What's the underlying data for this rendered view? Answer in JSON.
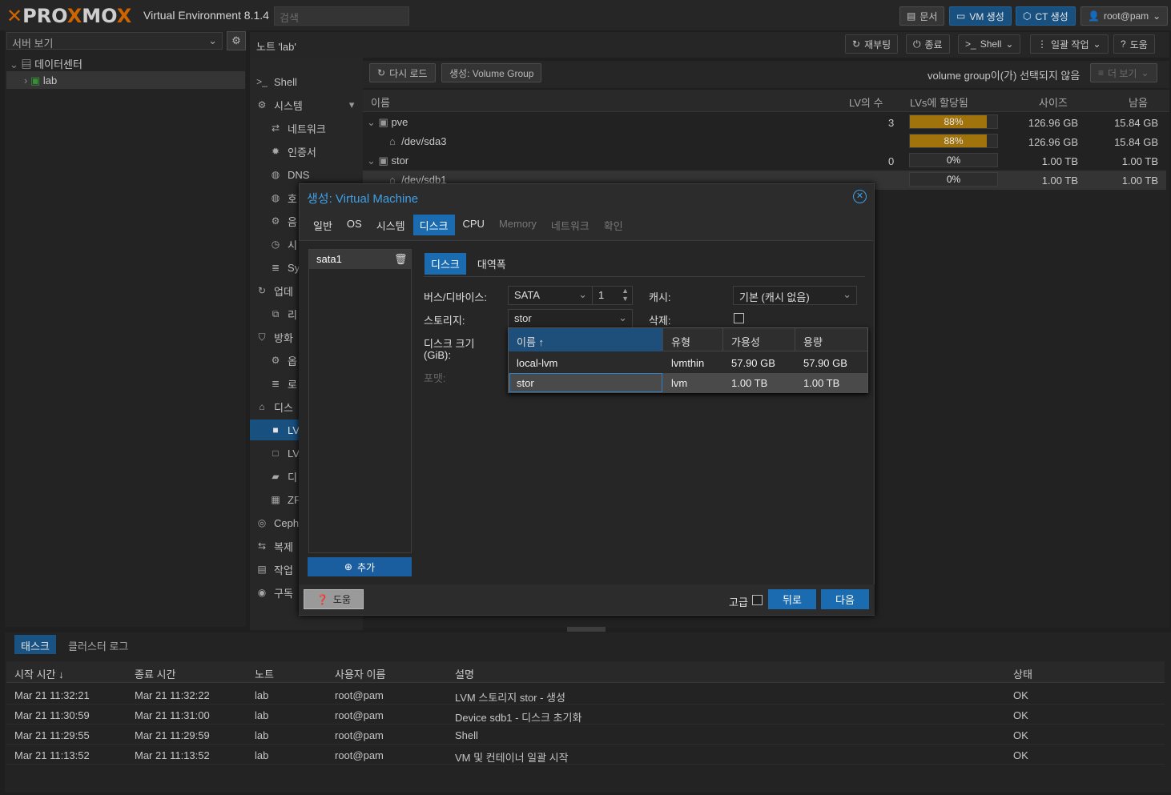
{
  "header": {
    "brand_a": "PRO",
    "brand_b": "X",
    "brand_c": "MO",
    "brand_d": "X",
    "version": "Virtual Environment 8.1.4",
    "search_placeholder": "검색",
    "docs": "문서",
    "create_vm": "VM 생성",
    "create_ct": "CT 생성",
    "user": "root@pam"
  },
  "sidebar": {
    "view": "서버 보기",
    "datacenter": "데이터센터",
    "node": "lab"
  },
  "titlebar": {
    "title": "노트 'lab'",
    "reboot": "재부팅",
    "shutdown": "종료",
    "shell": "Shell",
    "bulk": "일괄 작업",
    "help": "도움"
  },
  "nav": {
    "items": [
      "Shell",
      "시스템",
      "네트워크",
      "인증서",
      "DNS",
      "호",
      "음",
      "시",
      "Sy",
      "업데",
      "리",
      "방화",
      "옵",
      "로",
      "디스",
      "LV",
      "LV",
      "디",
      "ZF",
      "Ceph",
      "복제",
      "작업",
      "구독"
    ]
  },
  "content": {
    "reload": "다시 로드",
    "create_vg": "생성: Volume Group",
    "no_vg": "volume group이(가) 선택되지 않음",
    "more": "더 보기",
    "cols": [
      "이름",
      "LV의 수",
      "LVs에 할당됨",
      "사이즈",
      "남음"
    ],
    "rows": [
      {
        "name": "pve",
        "lvs": "3",
        "usage": "88%",
        "pct": 0.88,
        "size": "126.96 GB",
        "free": "15.84 GB"
      },
      {
        "name": "/dev/sda3",
        "lvs": "",
        "usage": "88%",
        "pct": 0.88,
        "size": "126.96 GB",
        "free": "15.84 GB"
      },
      {
        "name": "stor",
        "lvs": "0",
        "usage": "0%",
        "pct": 0,
        "size": "1.00 TB",
        "free": "1.00 TB"
      },
      {
        "name": "/dev/sdb1",
        "lvs": "",
        "usage": "0%",
        "pct": 0,
        "size": "1.00 TB",
        "free": "1.00 TB"
      }
    ]
  },
  "dialog": {
    "title": "생성: Virtual Machine",
    "tabs": [
      "일반",
      "OS",
      "시스템",
      "디스크",
      "CPU",
      "Memory",
      "네트워크",
      "확인"
    ],
    "disk_item": "sata1",
    "add": "추가",
    "subtabs": [
      "디스크",
      "대역폭"
    ],
    "bus_label": "버스/디바이스:",
    "bus": "SATA",
    "bus_num": "1",
    "storage_label": "스토리지:",
    "storage": "stor",
    "size_label": "디스크 크기",
    "size_label2": "(GiB):",
    "format_label": "포맷:",
    "cache_label": "캐시:",
    "cache": "기본 (캐시 없음)",
    "discard_label": "삭제:",
    "dd_cols": [
      "이름 ↑",
      "유형",
      "가용성",
      "용량"
    ],
    "dd_rows": [
      [
        "local-lvm",
        "lvmthin",
        "57.90 GB",
        "57.90 GB"
      ],
      [
        "stor",
        "lvm",
        "1.00 TB",
        "1.00 TB"
      ]
    ],
    "help": "도움",
    "advanced": "고급",
    "back": "뒤로",
    "next": "다음"
  },
  "log": {
    "tabs": [
      "태스크",
      "클러스터 로그"
    ],
    "cols": [
      "시작 시간 ↓",
      "종료 시간",
      "노트",
      "사용자 이름",
      "설명",
      "상태"
    ],
    "rows": [
      [
        "Mar 21 11:32:21",
        "Mar 21 11:32:22",
        "lab",
        "root@pam",
        "LVM 스토리지 stor - 생성",
        "OK"
      ],
      [
        "Mar 21 11:30:59",
        "Mar 21 11:31:00",
        "lab",
        "root@pam",
        "Device sdb1 - 디스크 초기화",
        "OK"
      ],
      [
        "Mar 21 11:29:55",
        "Mar 21 11:29:59",
        "lab",
        "root@pam",
        "Shell",
        "OK"
      ],
      [
        "Mar 21 11:13:52",
        "Mar 21 11:13:52",
        "lab",
        "root@pam",
        "VM 및 컨테이너 일괄 시작",
        "OK"
      ]
    ]
  },
  "colors": {
    "accent": "#1b6bb0",
    "usage": "#b3810f",
    "brand": "#e57000"
  }
}
